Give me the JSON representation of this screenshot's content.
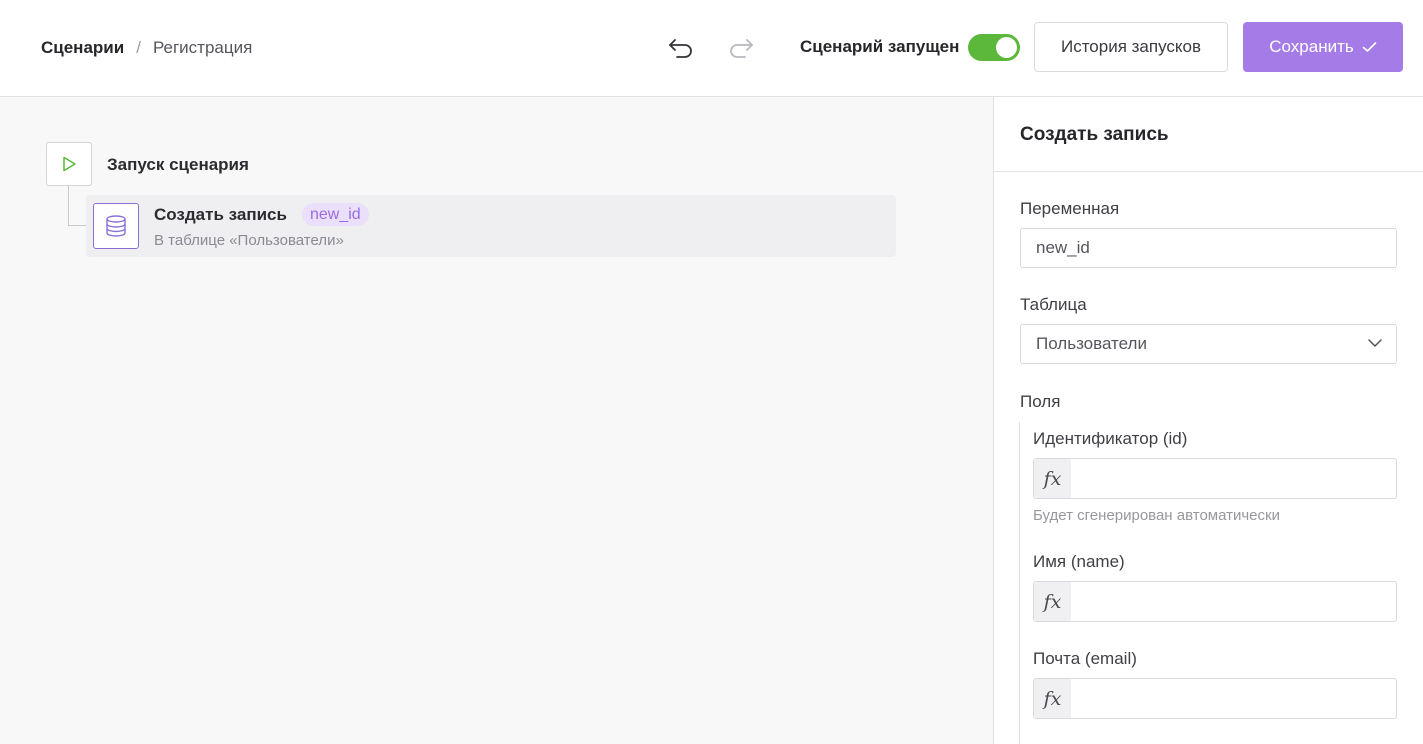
{
  "header": {
    "breadcrumb_root": "Сценарии",
    "breadcrumb_sep": "/",
    "breadcrumb_current": "Регистрация",
    "run_status_label": "Сценарий запущен",
    "run_enabled": true,
    "history_label": "История запусков",
    "save_label": "Сохранить",
    "icons": {
      "undo": "undo-icon",
      "redo": "redo-icon",
      "save_check": "check-icon"
    }
  },
  "canvas": {
    "start_node_label": "Запуск сценария",
    "node": {
      "title": "Создать запись",
      "badge": "new_id",
      "subtitle": "В таблице «Пользователи»",
      "icon": "database-icon"
    }
  },
  "panel": {
    "title": "Создать запись",
    "variable_label": "Переменная",
    "variable_value": "new_id",
    "table_label": "Таблица",
    "table_value": "Пользователи",
    "fields_label": "Поля",
    "fields": [
      {
        "label": "Идентификатор (id)",
        "hint": "Будет сгенерирован автоматически",
        "fx": "fx"
      },
      {
        "label": "Имя (name)",
        "fx": "fx"
      },
      {
        "label": "Почта (email)",
        "fx": "fx"
      }
    ]
  },
  "colors": {
    "accent": "#a57be8",
    "toggle_on": "#5cb83a",
    "badge_bg": "#ebe0fb",
    "badge_text": "#9b6cde",
    "node_icon_border": "#8b6fd6"
  }
}
